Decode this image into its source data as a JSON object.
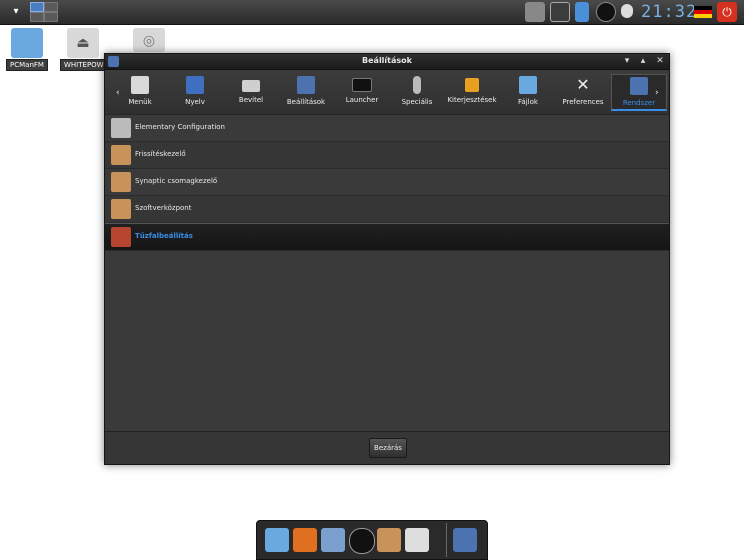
{
  "top_panel": {
    "menu_icon": "chevron-down-icon",
    "clock": "21:32",
    "tray": [
      "network-icon",
      "updates-icon",
      "notes-icon",
      "media-icon",
      "bulb-icon",
      "flag-de-icon",
      "power-icon"
    ]
  },
  "desktop": {
    "icons": [
      {
        "label": "PCManFM",
        "icon": "home-folder-icon"
      },
      {
        "label": "WHITEPOW",
        "icon": "eject-drive-icon"
      },
      {
        "label": "",
        "icon": "disc-icon"
      }
    ]
  },
  "window": {
    "title": "Beállítások",
    "tabs": [
      {
        "label": "Menük",
        "icon": "menu-file-icon",
        "color": "#d9d9d9"
      },
      {
        "label": "Nyelv",
        "icon": "language-globe-icon",
        "color": "#3f6fc0"
      },
      {
        "label": "Bevitel",
        "icon": "keyboard-icon",
        "color": "#cfcfcf"
      },
      {
        "label": "Beállítások",
        "icon": "wrench-icon",
        "color": "#4c73b0"
      },
      {
        "label": "Launcher",
        "icon": "terminal-icon",
        "color": "#111111"
      },
      {
        "label": "Speciális",
        "icon": "drop-icon",
        "color": "#bbbbbb"
      },
      {
        "label": "Kiterjesztések",
        "icon": "puzzle-icon",
        "color": "#e8a020"
      },
      {
        "label": "Fájlok",
        "icon": "folder-icon",
        "color": "#6aa8e0"
      },
      {
        "label": "Preferences",
        "icon": "tools-icon",
        "color": "#eeeeee"
      },
      {
        "label": "Rendszer",
        "icon": "system-wrench-icon",
        "color": "#4c73b0"
      }
    ],
    "active_tab": "Rendszer",
    "items": [
      {
        "label": "Elementary Configuration",
        "icon": "elementary-icon",
        "color": "#bbbbbb"
      },
      {
        "label": "Frissítéskezelő",
        "icon": "update-package-icon",
        "color": "#c8935a"
      },
      {
        "label": "Synaptic csomagkezelő",
        "icon": "synaptic-package-icon",
        "color": "#c8935a"
      },
      {
        "label": "Szoftverközpont",
        "icon": "software-center-icon",
        "color": "#c8935a"
      },
      {
        "label": "Tűzfalbeállítás",
        "icon": "firewall-icon",
        "color": "#b5452f"
      }
    ],
    "selected_item": "Tűzfalbeállítás",
    "close_label": "Bezárás"
  },
  "dock": {
    "items": [
      "files-icon",
      "eye-icon",
      "settings-icon",
      "letter-a-icon",
      "package-icon",
      "terminal-drive-icon",
      "wrench-icon"
    ]
  },
  "colors": {
    "accent": "#3a8ee6",
    "panel": "#2a2a2a"
  }
}
